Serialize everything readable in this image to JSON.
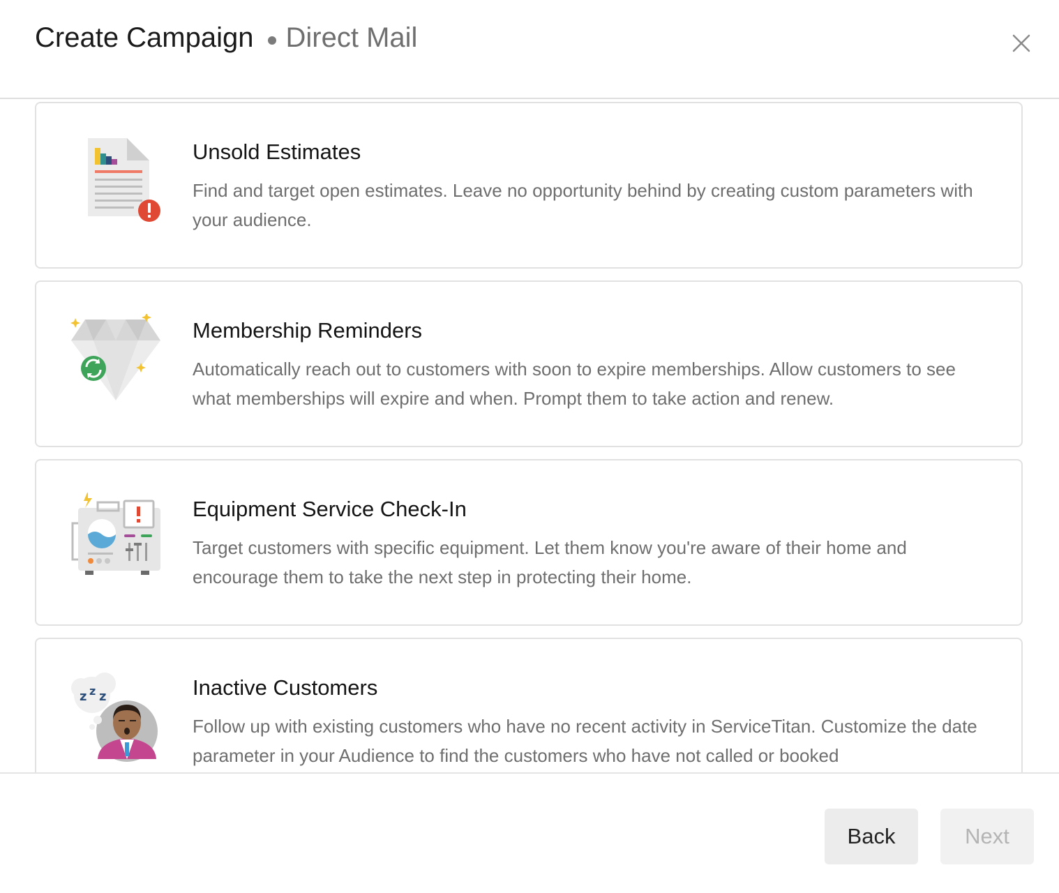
{
  "header": {
    "title": "Create Campaign",
    "subtitle": "Direct Mail",
    "close_icon": "close-icon"
  },
  "campaign_types": [
    {
      "title": "Unsold Estimates",
      "description": "Find and target open estimates. Leave no opportunity behind by creating custom parameters with your audience.",
      "icon": "estimate-document-icon"
    },
    {
      "title": "Membership Reminders",
      "description": "Automatically reach out to customers with soon to expire memberships. Allow customers to see what memberships will expire and when. Prompt them to take action and renew.",
      "icon": "diamond-renew-icon"
    },
    {
      "title": "Equipment Service Check-In",
      "description": "Target customers with specific equipment. Let them know you're aware of their home and encourage them to take the next step in protecting their home.",
      "icon": "equipment-alert-icon"
    },
    {
      "title": "Inactive Customers",
      "description": "Follow up with existing customers who have no recent activity in ServiceTitan. Customize the date parameter in your Audience to find the customers who have not called or booked",
      "icon": "sleeping-customer-icon"
    }
  ],
  "footer": {
    "back_label": "Back",
    "next_label": "Next"
  },
  "colors": {
    "next_disabled_bg": "#f1f1f1",
    "back_bg": "#ececec",
    "alert_red": "#e04a35",
    "renew_green": "#3ea45a"
  }
}
